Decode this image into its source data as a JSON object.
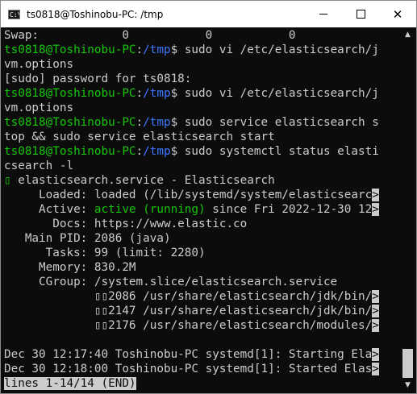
{
  "window": {
    "title": "ts0818@Toshinobu-PC: /tmp",
    "icon_text": "C:\\",
    "icons": {
      "app": "terminal-icon",
      "minimize": "minimize-icon",
      "maximize": "maximize-icon",
      "close": "close-icon"
    }
  },
  "terminal": {
    "lines": [
      [
        {
          "t": "Swap:            0           0           0"
        }
      ],
      [
        {
          "t": "ts0818@Toshinobu-PC",
          "c": "user"
        },
        {
          "t": ":"
        },
        {
          "t": "/tmp",
          "c": "path"
        },
        {
          "t": "$ sudo vi /etc/elasticsearch/j"
        }
      ],
      [
        {
          "t": "vm.options"
        }
      ],
      [
        {
          "t": "[sudo] password for ts0818:"
        }
      ],
      [
        {
          "t": "ts0818@Toshinobu-PC",
          "c": "user"
        },
        {
          "t": ":"
        },
        {
          "t": "/tmp",
          "c": "path"
        },
        {
          "t": "$ sudo vi /etc/elasticsearch/j"
        }
      ],
      [
        {
          "t": "vm.options"
        }
      ],
      [
        {
          "t": "ts0818@Toshinobu-PC",
          "c": "user"
        },
        {
          "t": ":"
        },
        {
          "t": "/tmp",
          "c": "path"
        },
        {
          "t": "$ sudo service elasticsearch s"
        }
      ],
      [
        {
          "t": "top && sudo service elasticsearch start"
        }
      ],
      [
        {
          "t": "ts0818@Toshinobu-PC",
          "c": "user"
        },
        {
          "t": ":"
        },
        {
          "t": "/tmp",
          "c": "path"
        },
        {
          "t": "$ sudo systemctl status elasti"
        }
      ],
      [
        {
          "t": "csearch -l"
        }
      ],
      [
        {
          "t": "▯",
          "c": "dot"
        },
        {
          "t": " elasticsearch.service - Elasticsearch"
        }
      ],
      [
        {
          "t": "     Loaded: loaded (/lib/systemd/system/elasticsearc"
        },
        {
          "t": ">",
          "c": "trunc"
        }
      ],
      [
        {
          "t": "     Active: "
        },
        {
          "t": "active (running)",
          "c": "active"
        },
        {
          "t": " since Fri 2022-12-30 12"
        },
        {
          "t": ">",
          "c": "trunc"
        }
      ],
      [
        {
          "t": "       Docs: https://www.elastic.co"
        }
      ],
      [
        {
          "t": "   Main PID: 2086 (java)"
        }
      ],
      [
        {
          "t": "      Tasks: 99 (limit: 2280)"
        }
      ],
      [
        {
          "t": "     Memory: 830.2M"
        }
      ],
      [
        {
          "t": "     CGroup: /system.slice/elasticsearch.service"
        }
      ],
      [
        {
          "t": "             ▯▯2086 /usr/share/elasticsearch/jdk/bin/"
        },
        {
          "t": ">",
          "c": "trunc"
        }
      ],
      [
        {
          "t": "             ▯▯2147 /usr/share/elasticsearch/jdk/bin/"
        },
        {
          "t": ">",
          "c": "trunc"
        }
      ],
      [
        {
          "t": "             ▯▯2176 /usr/share/elasticsearch/modules/"
        },
        {
          "t": ">",
          "c": "trunc"
        }
      ],
      [
        {
          "t": ""
        }
      ],
      [
        {
          "t": "Dec 30 12:17:40 Toshinobu-PC systemd[1]: Starting Ela"
        },
        {
          "t": ">",
          "c": "trunc"
        }
      ],
      [
        {
          "t": "Dec 30 12:18:00 Toshinobu-PC systemd[1]: Started Elas"
        },
        {
          "t": ">",
          "c": "trunc"
        }
      ],
      [
        {
          "t": "lines 1-14/14 (END)",
          "c": "footer-inv"
        }
      ]
    ]
  },
  "scrollbar": {
    "up_icon": "▲",
    "down_icon": "▼"
  }
}
